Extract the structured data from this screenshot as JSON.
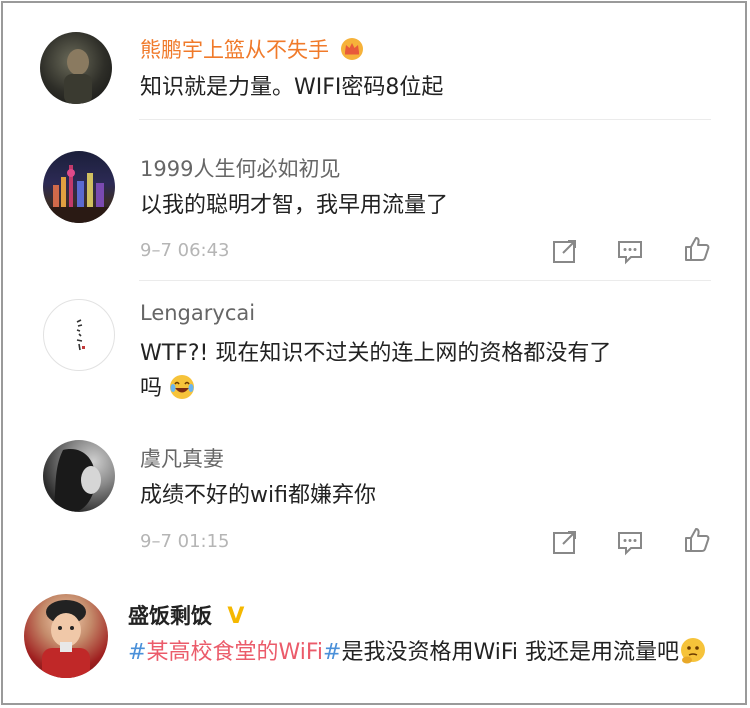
{
  "comments": [
    {
      "username": "熊鹏宇上篮从不失手",
      "username_color": "#f07a2a",
      "badge_icon": "crown-icon",
      "text": "知识就是力量。WIFI密码8位起"
    },
    {
      "username": "1999人生何必如初见",
      "text": "以我的聪明才智，我早用流量了",
      "timestamp": "9–7 06:43"
    },
    {
      "username": "Lengarycai",
      "text_line1": "WTF?! 现在知识不过关的连上网的资格都没有了",
      "text_line2": "吗",
      "emoji_icon": "laughing-tears-emoji"
    },
    {
      "username": "虞凡真妻",
      "text": "成绩不好的wifi都嫌弃你",
      "timestamp": "9–7 01:15"
    }
  ],
  "repost": {
    "username": "盛饭剩饭",
    "verified_badge": "V",
    "topic_hash_open": "#",
    "topic": "某高校食堂的WiFi",
    "topic_hash_close": "#",
    "text": "是我没资格用WiFi 我还是用流量吧",
    "emoji_icon": "thinking-emoji"
  },
  "colors": {
    "accent_orange": "#f07a2a",
    "topic_red": "#eb5b6a",
    "hash_blue": "#4a90d9",
    "verified_yellow": "#f5b800"
  }
}
